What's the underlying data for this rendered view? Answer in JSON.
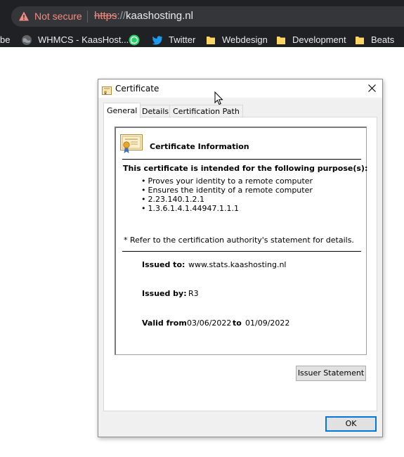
{
  "browser": {
    "security_status": "Not secure",
    "url_scheme": "https",
    "url_separator": "://",
    "url_host": "kaashosting.nl",
    "bookmarks": [
      {
        "label": "be",
        "icon": "none"
      },
      {
        "label": "WHMCS - KaasHost...",
        "icon": "globe-icon"
      },
      {
        "label": "",
        "icon": "whatsapp-icon"
      },
      {
        "label": "Twitter",
        "icon": "twitter-icon"
      },
      {
        "label": "Webdesign",
        "icon": "folder-icon"
      },
      {
        "label": "Development",
        "icon": "folder-icon"
      },
      {
        "label": "Beats",
        "icon": "folder-icon"
      }
    ]
  },
  "dialog": {
    "title": "Certificate",
    "tabs": [
      {
        "label": "General",
        "active": true
      },
      {
        "label": "Details",
        "active": false
      },
      {
        "label": "Certification Path",
        "active": false
      }
    ],
    "info_title": "Certificate Information",
    "purpose_heading": "This certificate is intended for the following purpose(s):",
    "purposes": [
      "Proves your identity to a remote computer",
      "Ensures the identity of a remote computer",
      "2.23.140.1.2.1",
      "1.3.6.1.4.1.44947.1.1.1"
    ],
    "refer_note": "* Refer to the certification authority's statement for details.",
    "issued_to_label": "Issued to:",
    "issued_to": "www.stats.kaashosting.nl",
    "issued_by_label": "Issued by:",
    "issued_by": "R3",
    "valid_from_label": "Valid from",
    "valid_from": "03/06/2022",
    "valid_to_label": "to",
    "valid_to": "01/09/2022",
    "issuer_statement_button": "Issuer Statement",
    "ok_button": "OK"
  },
  "colors": {
    "chrome_bg": "#202124",
    "omnibox_bg": "#35363a",
    "not_secure": "#f28b82",
    "dialog_bg": "#f0f0f0",
    "default_button_border": "#0078d7"
  }
}
